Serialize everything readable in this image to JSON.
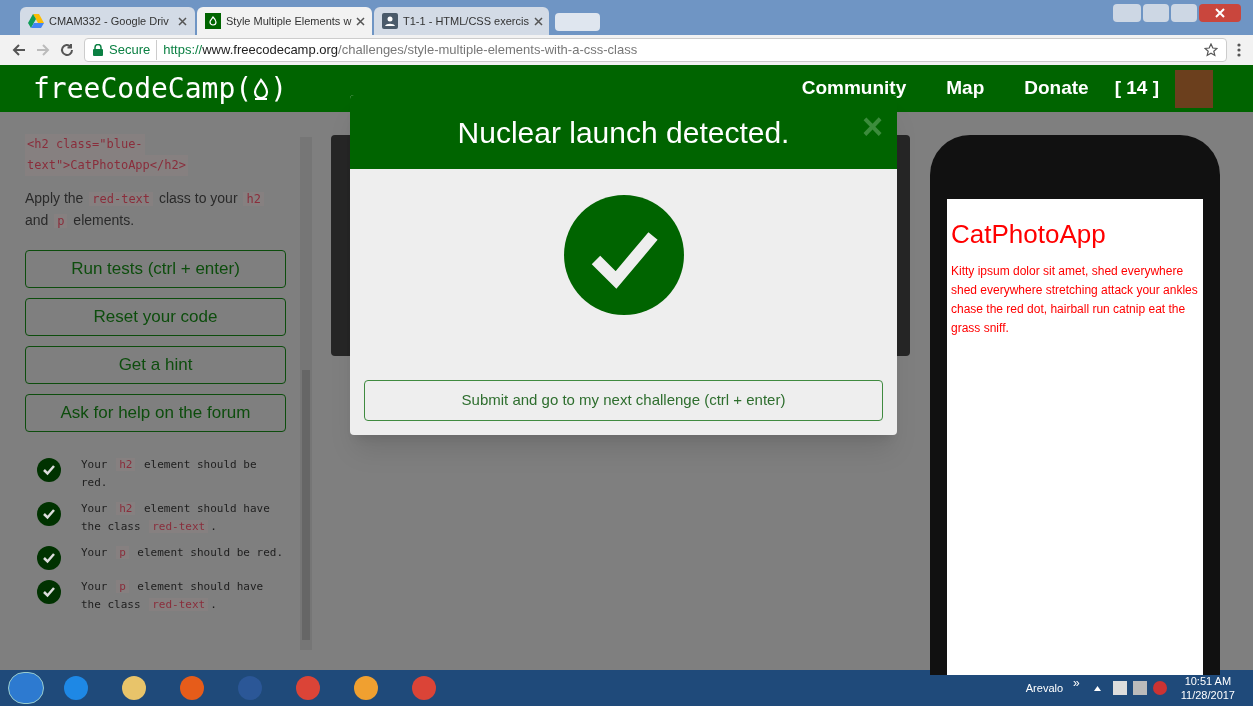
{
  "browser": {
    "tabs": [
      {
        "title": "CMAM332 - Google Driv",
        "selected": false
      },
      {
        "title": "Style Multiple Elements w",
        "selected": true
      },
      {
        "title": "T1-1 - HTML/CSS exercis",
        "selected": false
      }
    ],
    "secure_label": "Secure",
    "url_scheme": "https://",
    "url_host": "www.freecodecamp.org",
    "url_path": "/challenges/style-multiple-elements-with-a-css-class"
  },
  "nav": {
    "logo": "freeCodeCamp(",
    "logo_end": ")",
    "links": [
      "Community",
      "Map",
      "Donate"
    ],
    "points": "[ 14 ]"
  },
  "sidebar": {
    "code_lines": [
      "<h2 class=\"blue-",
      "text\">CatPhotoApp</h2>"
    ],
    "instruction": [
      {
        "kind": "text",
        "text": "Apply the "
      },
      {
        "kind": "code",
        "text": "red-text"
      },
      {
        "kind": "text",
        "text": " class to your "
      },
      {
        "kind": "code",
        "text": "h2"
      },
      {
        "kind": "text",
        "text": " and "
      },
      {
        "kind": "code",
        "text": "p"
      },
      {
        "kind": "text",
        "text": " elements."
      }
    ],
    "buttons": [
      "Run tests (ctrl + enter)",
      "Reset your code",
      "Get a hint",
      "Ask for help on the forum"
    ],
    "tests": [
      {
        "passed": true,
        "parts": [
          {
            "kind": "text",
            "text": "Your "
          },
          {
            "kind": "code",
            "text": "h2"
          },
          {
            "kind": "text",
            "text": " element should be red."
          }
        ]
      },
      {
        "passed": true,
        "parts": [
          {
            "kind": "text",
            "text": "Your "
          },
          {
            "kind": "code",
            "text": "h2"
          },
          {
            "kind": "text",
            "text": " element should have the class "
          },
          {
            "kind": "code",
            "text": "red-text"
          },
          {
            "kind": "text",
            "text": "."
          }
        ]
      },
      {
        "passed": true,
        "parts": [
          {
            "kind": "text",
            "text": "Your "
          },
          {
            "kind": "code",
            "text": "p"
          },
          {
            "kind": "text",
            "text": " element should be red."
          }
        ]
      },
      {
        "passed": true,
        "parts": [
          {
            "kind": "text",
            "text": "Your "
          },
          {
            "kind": "code",
            "text": "p"
          },
          {
            "kind": "text",
            "text": " element should have the class "
          },
          {
            "kind": "code",
            "text": "red-text"
          },
          {
            "kind": "text",
            "text": "."
          }
        ]
      }
    ]
  },
  "modal": {
    "title": "Nuclear launch detected.",
    "close": "×",
    "submit": "Submit and go to my next challenge (ctrl + enter)"
  },
  "preview": {
    "heading": "CatPhotoApp",
    "paragraph": "Kitty ipsum dolor sit amet, shed everywhere shed everywhere stretching attack your ankles chase the red dot, hairball run catnip eat the grass sniff."
  },
  "taskbar": {
    "user": "Arevalo",
    "chevron": "»",
    "time": "10:51 AM",
    "date": "11/28/2017"
  }
}
